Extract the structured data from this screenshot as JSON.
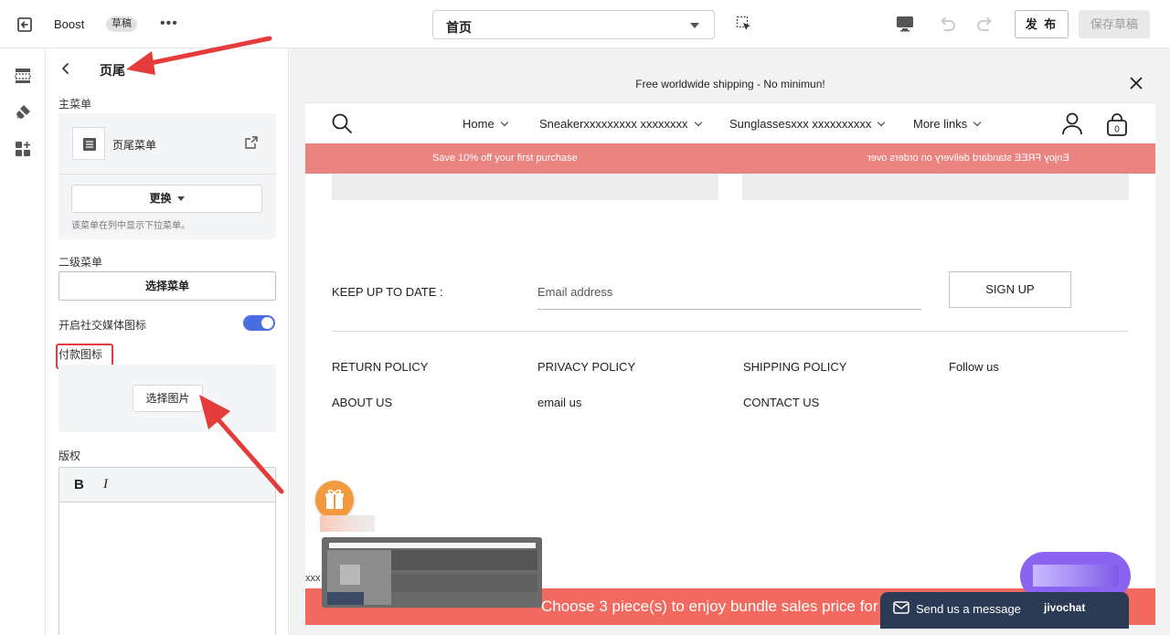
{
  "topbar": {
    "app_name": "Boost",
    "badge": "草稿",
    "more": "•••",
    "page_selector": "首页",
    "publish": "发 布",
    "save_draft": "保存草稿"
  },
  "panel": {
    "title": "页尾",
    "main_menu_label": "主菜单",
    "menu_name": "页尾菜单",
    "change_button": "更换",
    "change_hint": "该菜单在列中显示下拉菜单。",
    "secondary_menu_label": "二级菜单",
    "select_menu_button": "选择菜单",
    "social_icons_label": "开启社交媒体图标",
    "social_icons_enabled": true,
    "payment_icons_label": "付款图标",
    "select_image_button": "选择图片",
    "copyright_label": "版权",
    "bold": "B",
    "italic": "I"
  },
  "site": {
    "announcement": "Free worldwide shipping - No minimun!",
    "nav": [
      {
        "label": "Home"
      },
      {
        "label": "Sneakerxxxxxxxxx xxxxxxxx"
      },
      {
        "label": "Sunglassesxxx xxxxxxxxxx"
      },
      {
        "label": "More links"
      }
    ],
    "cart_count": "0",
    "promo_left": "Save 10% off your first purchase",
    "promo_right": "Enjoy FREE standard delivery on orders over",
    "newsletter_label": "KEEP UP TO DATE :",
    "email_placeholder": "Email address",
    "signup": "SIGN UP",
    "footer_links": [
      [
        "RETURN POLICY",
        "ABOUT US"
      ],
      [
        "PRIVACY POLICY",
        "email us"
      ],
      [
        "SHIPPING POLICY",
        "CONTACT US"
      ],
      [
        "Follow us"
      ]
    ],
    "bundle_banner": "Choose 3 piece(s) to enjoy bundle sales price for",
    "xxx": "xxx"
  },
  "chat": {
    "send_message": "Send us a message",
    "brand": "jivochat"
  },
  "colors": {
    "accent": "#4a6ee0",
    "promo": "#e9837f",
    "bundle": "#f26a5f",
    "annotation": "#e53b3b",
    "chat_bar": "#2b3a55"
  }
}
